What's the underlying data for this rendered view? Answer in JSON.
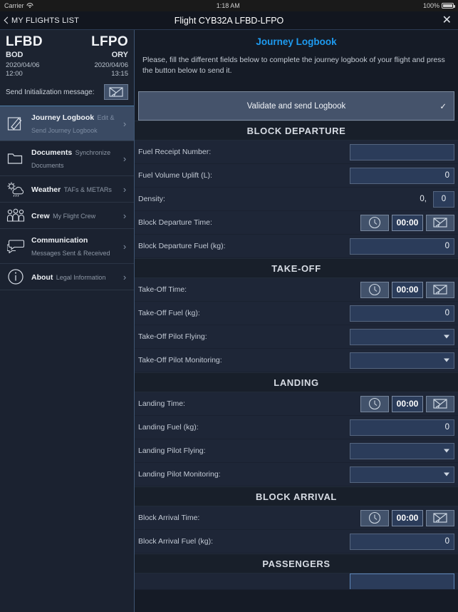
{
  "status_bar": {
    "carrier": "Carrier",
    "wifi_icon": "wifi-icon",
    "time": "1:18 AM",
    "battery_percent": "100%",
    "battery_icon": "battery-full-icon"
  },
  "nav_bar": {
    "back_icon": "chevron-left-icon",
    "back_label": "MY FLIGHTS LIST",
    "title": "Flight CYB32A LFBD-LFPO",
    "close_icon": "close-icon"
  },
  "sidebar": {
    "flight_header": {
      "departure_icao": "LFBD",
      "arrival_icao": "LFPO",
      "departure_city": "BOD",
      "arrival_city": "ORY",
      "departure_date": "2020/04/06",
      "arrival_date": "2020/04/06",
      "departure_time": "12:00",
      "arrival_time": "13:15",
      "init_label": "Send Initialization message:",
      "init_button_icon": "envelope-icon"
    },
    "items": [
      {
        "title": "Journey Logbook",
        "subtitle": "Edit & Send Journey Logbook",
        "icon": "pencil-note-icon",
        "active": true
      },
      {
        "title": "Documents",
        "subtitle": "Synchronize Documents",
        "icon": "folder-icon",
        "active": false
      },
      {
        "title": "Weather",
        "subtitle": "TAFs & METARs",
        "icon": "sun-cloud-rain-icon",
        "active": false
      },
      {
        "title": "Crew",
        "subtitle": "My Flight Crew",
        "icon": "people-icon",
        "active": false
      },
      {
        "title": "Communication",
        "subtitle": "Messages Sent & Received",
        "icon": "chat-bubbles-icon",
        "active": false
      },
      {
        "title": "About",
        "subtitle": "Legal Information",
        "icon": "info-circle-icon",
        "active": false
      }
    ],
    "chevron_icon": "chevron-right-icon"
  },
  "main": {
    "title": "Journey Logbook",
    "description": "Please, fill the different fields below to complete the journey logbook of your flight and press the button below to send it.",
    "validate_button": {
      "label": "Validate and send Logbook",
      "check_icon": "check-icon"
    },
    "sections": [
      {
        "header": "BLOCK DEPARTURE",
        "rows": [
          {
            "type": "text",
            "label": "Fuel Receipt Number:",
            "value": ""
          },
          {
            "type": "text",
            "label": "Fuel Volume Uplift (L):",
            "value": "0"
          },
          {
            "type": "density",
            "label": "Density:",
            "prefix": "0,",
            "value": "0"
          },
          {
            "type": "time",
            "label": "Block Departure Time:",
            "value": "00:00",
            "clock_icon": "clock-icon",
            "mail_icon": "envelope-icon"
          },
          {
            "type": "text",
            "label": "Block Departure Fuel (kg):",
            "value": "0"
          }
        ]
      },
      {
        "header": "TAKE-OFF",
        "rows": [
          {
            "type": "time",
            "label": "Take-Off Time:",
            "value": "00:00",
            "clock_icon": "clock-icon",
            "mail_icon": "envelope-icon"
          },
          {
            "type": "text",
            "label": "Take-Off Fuel (kg):",
            "value": "0"
          },
          {
            "type": "select",
            "label": "Take-Off Pilot Flying:",
            "value": ""
          },
          {
            "type": "select",
            "label": "Take-Off Pilot Monitoring:",
            "value": ""
          }
        ]
      },
      {
        "header": "LANDING",
        "rows": [
          {
            "type": "time",
            "label": "Landing Time:",
            "value": "00:00",
            "clock_icon": "clock-icon",
            "mail_icon": "envelope-icon"
          },
          {
            "type": "text",
            "label": "Landing Fuel (kg):",
            "value": "0"
          },
          {
            "type": "select",
            "label": "Landing Pilot Flying:",
            "value": ""
          },
          {
            "type": "select",
            "label": "Landing Pilot Monitoring:",
            "value": ""
          }
        ]
      },
      {
        "header": "BLOCK ARRIVAL",
        "rows": [
          {
            "type": "time",
            "label": "Block Arrival Time:",
            "value": "00:00",
            "clock_icon": "clock-icon",
            "mail_icon": "envelope-icon"
          },
          {
            "type": "text",
            "label": "Block Arrival Fuel (kg):",
            "value": "0"
          }
        ]
      },
      {
        "header": "PASSENGERS",
        "rows": [
          {
            "type": "partial",
            "label": "",
            "value": ""
          }
        ]
      }
    ]
  },
  "colors": {
    "accent_blue": "#1e9bf0",
    "panel_bg": "#1b2230",
    "main_bg": "#151b26",
    "row_bg": "#1e2637",
    "section_header_bg": "#181f2a",
    "input_bg": "#2b3c5a",
    "button_bg": "#45536b",
    "selected_item_bg": "#3a4a63",
    "divider": "#4f7ea8"
  }
}
